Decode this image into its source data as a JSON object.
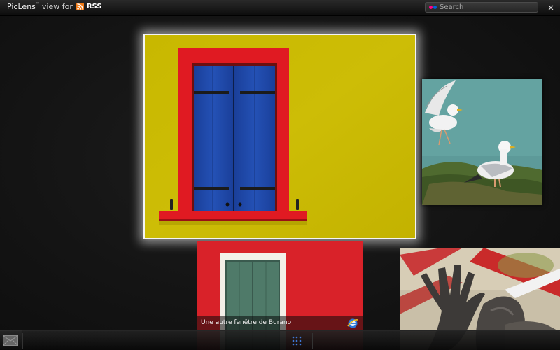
{
  "header": {
    "app_name": "PicLens",
    "trademark": "™",
    "view_for": "view for",
    "feed_label": "RSS"
  },
  "search": {
    "placeholder": "Search",
    "value": ""
  },
  "controls": {
    "close_label": "×"
  },
  "photos": {
    "current_caption": "Une autre fenêtre de Burano"
  },
  "colors": {
    "rss_orange": "#f07a16",
    "flickr_pink": "#ff0084",
    "flickr_blue": "#0063dc",
    "highlight_border": "#f4f4f4"
  },
  "icons": {
    "rss": "rss-icon",
    "flickr": "flickr-icon",
    "close": "close-icon",
    "browser": "ie-browser-icon",
    "email": "envelope-icon",
    "grid": "grid-icon"
  }
}
